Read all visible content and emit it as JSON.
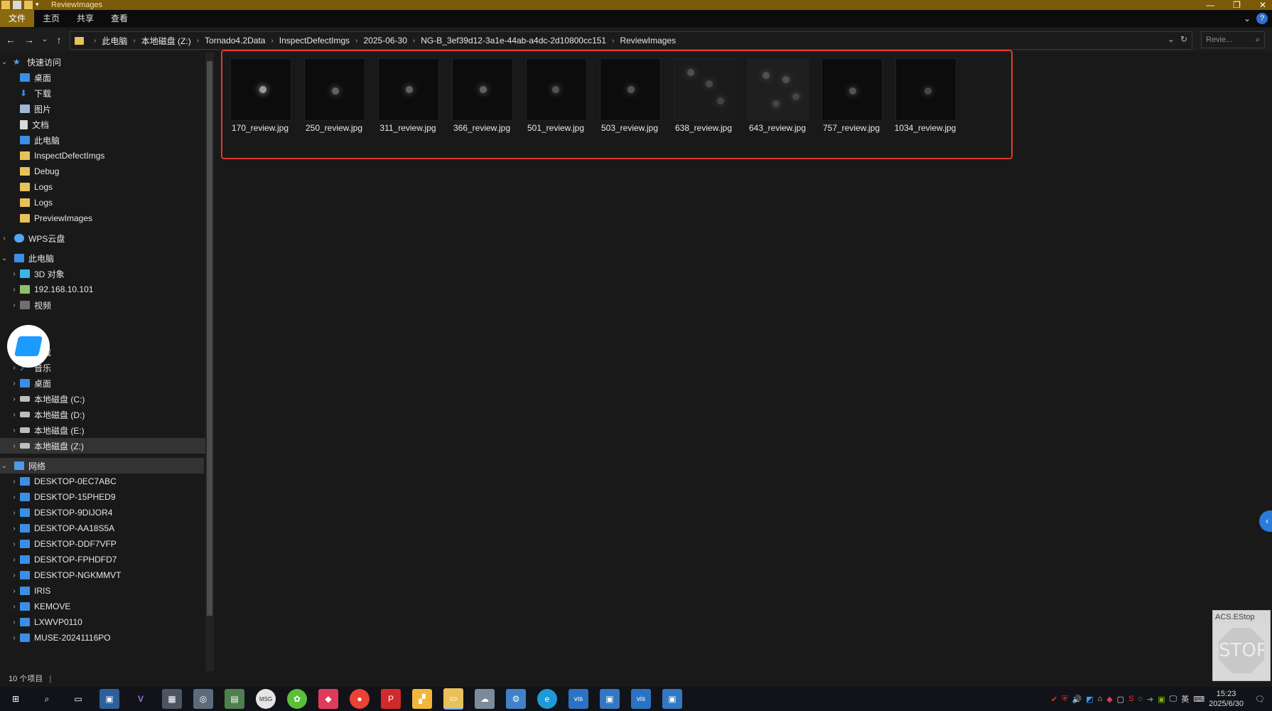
{
  "window": {
    "title": "ReviewImages"
  },
  "ribbon": {
    "tabs": [
      "文件",
      "主页",
      "共享",
      "查看"
    ]
  },
  "address": {
    "crumbs": [
      "此电脑",
      "本地磁盘 (Z:)",
      "Tornado4.2Data",
      "InspectDefectImgs",
      "2025-06-30",
      "NG-B_3ef39d12-3a1e-44ab-a4dc-2d10800cc151",
      "ReviewImages"
    ]
  },
  "search": {
    "placeholder": "Revie..."
  },
  "nav": {
    "quick_access": "快速访问",
    "quick_items": [
      "桌面",
      "下载",
      "图片",
      "文档",
      "此电脑",
      "InspectDefectImgs",
      "Debug",
      "Logs",
      "Logs",
      "PreviewImages"
    ],
    "wps": "WPS云盘",
    "this_pc": "此电脑",
    "pc_items": [
      "3D 对象",
      "192.168.10.101",
      "视频",
      "下载",
      "音乐",
      "桌面",
      "本地磁盘 (C:)",
      "本地磁盘 (D:)",
      "本地磁盘 (E:)",
      "本地磁盘 (Z:)"
    ],
    "network": "网络",
    "network_items": [
      "DESKTOP-0EC7ABC",
      "DESKTOP-15PHED9",
      "DESKTOP-9DIJOR4",
      "DESKTOP-AA18S5A",
      "DESKTOP-DDF7VFP",
      "DESKTOP-FPHDFD7",
      "DESKTOP-NGKMMVT",
      "IRIS",
      "KEMOVE",
      "LXWVP0110",
      "MUSE-20241116PO"
    ]
  },
  "files": [
    "170_review.jpg",
    "250_review.jpg",
    "311_review.jpg",
    "366_review.jpg",
    "501_review.jpg",
    "503_review.jpg",
    "638_review.jpg",
    "643_review.jpg",
    "757_review.jpg",
    "1034_review.jpg"
  ],
  "status": {
    "count": "10 个项目"
  },
  "tray": {
    "lang": "英",
    "time": "15:23",
    "date": "2025/6/30"
  },
  "estop": {
    "label": "ACS.EStop",
    "sign": "STOP"
  }
}
